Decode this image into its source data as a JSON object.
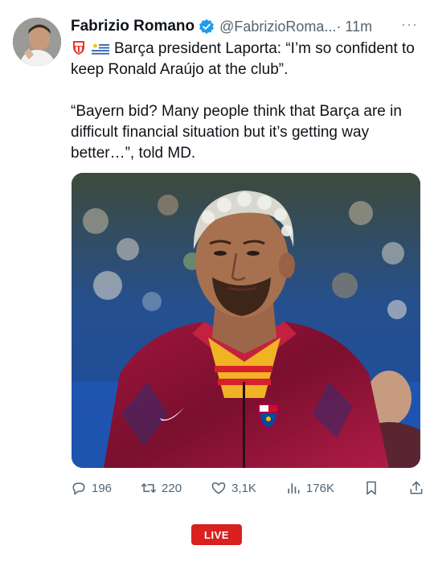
{
  "tweet": {
    "author_name": "Fabrizio Romano",
    "handle": "@FabrizioRoma...",
    "time": " · 11m",
    "more_label": "···",
    "line1": "Barça president Laporta: “I’m so confident to keep Ronald Araújo at the club”.",
    "line2": "“Bayern bid? Many people think that Barça are in difficult financial situation but it’s getting way better…”, told MD."
  },
  "actions": {
    "replies": "196",
    "retweets": "220",
    "likes": "3,1K",
    "views": "176K"
  },
  "live_label": "LIVE",
  "colors": {
    "verified": "#1d9bf0",
    "muted": "#536471",
    "live_red": "#d9211f"
  },
  "icons": [
    "verified-badge-icon",
    "barcelona-badge-icon",
    "uruguay-flag-icon",
    "reply-icon",
    "retweet-icon",
    "like-icon",
    "views-icon",
    "bookmark-icon",
    "share-icon"
  ]
}
